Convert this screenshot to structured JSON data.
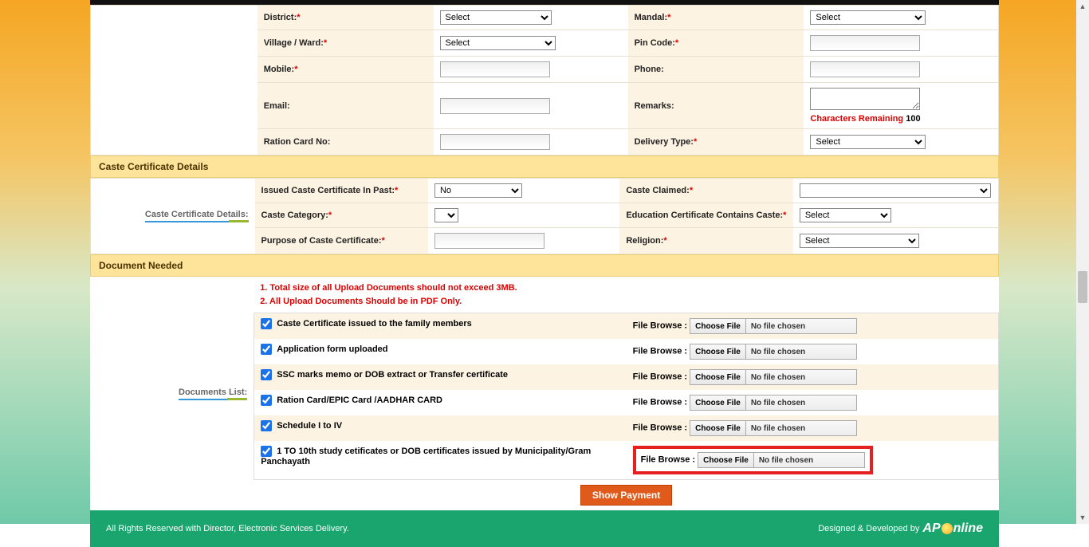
{
  "form": {
    "district_label": "District:",
    "mandal_label": "Mandal:",
    "village_label": "Village / Ward:",
    "pincode_label": "Pin Code:",
    "mobile_label": "Mobile:",
    "phone_label": "Phone:",
    "email_label": "Email:",
    "remarks_label": "Remarks:",
    "ration_label": "Ration Card No:",
    "delivery_label": "Delivery Type:",
    "chars_remaining_label": "Characters Remaining",
    "chars_remaining_value": "100",
    "select_opt": "Select"
  },
  "caste": {
    "section_title": "Caste Certificate Details",
    "sidebar_label": "Caste Certificate Details:",
    "issued_past_label": "Issued Caste Certificate In Past:",
    "issued_past_value": "No",
    "caste_claimed_label": "Caste Claimed:",
    "caste_category_label": "Caste Category:",
    "edu_contains_label": "Education Certificate Contains Caste:",
    "purpose_label": "Purpose of Caste Certificate:",
    "religion_label": "Religion:",
    "select_opt": "Select"
  },
  "docs": {
    "section_title": "Document Needed",
    "sidebar_label": "Documents List:",
    "note1": "1. Total size of all Upload Documents should not exceed 3MB.",
    "note2": "2. All Upload Documents Should be in PDF Only.",
    "file_browse_label": "File Browse :",
    "choose_file": "Choose File",
    "no_file": "No file chosen",
    "items": [
      "Caste Certificate issued to the family members",
      "Application form uploaded",
      "SSC marks memo or DOB extract or Transfer certificate",
      "Ration Card/EPIC Card /AADHAR CARD",
      "Schedule I to IV",
      "1 TO 10th study cetificates or DOB certificates issued by Municipality/Gram Panchayath"
    ]
  },
  "buttons": {
    "show_payment": "Show Payment"
  },
  "footer": {
    "left": "All Rights Reserved with Director, Electronic Services Delivery.",
    "right": "Designed & Developed by"
  }
}
